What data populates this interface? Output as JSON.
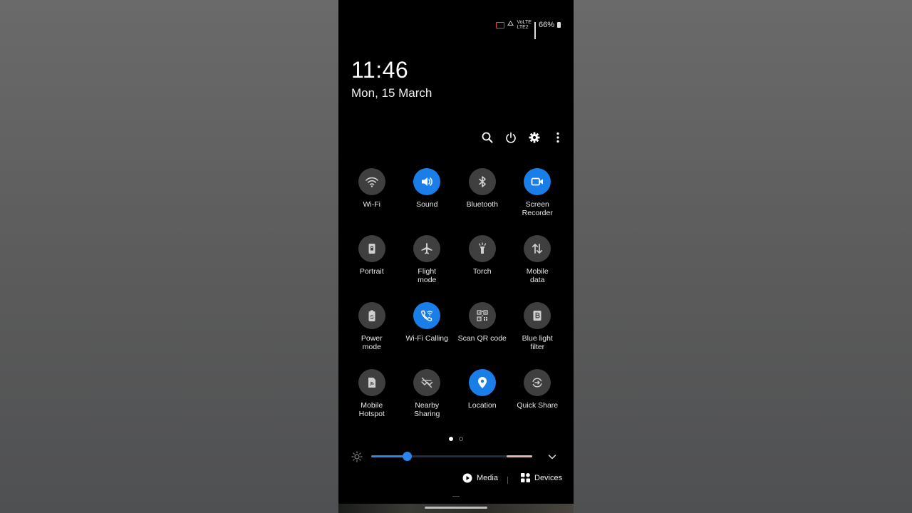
{
  "status_bar": {
    "battery_percent": "66%",
    "volte_label": "VoLTE",
    "lte_label": "LTE2"
  },
  "clock": {
    "time": "11:46",
    "date": "Mon, 15 March"
  },
  "top_actions": [
    "search-icon",
    "power-icon",
    "gear-icon",
    "more-vertical-icon"
  ],
  "tiles": [
    {
      "label": "Wi-Fi",
      "icon": "wifi-icon",
      "on": false
    },
    {
      "label": "Sound",
      "icon": "speaker-icon",
      "on": true
    },
    {
      "label": "Bluetooth",
      "icon": "bluetooth-icon",
      "on": false
    },
    {
      "label": "Screen\nRecorder",
      "icon": "video-camera-icon",
      "on": true
    },
    {
      "label": "Portrait",
      "icon": "rotation-lock-icon",
      "on": false
    },
    {
      "label": "Flight\nmode",
      "icon": "airplane-icon",
      "on": false
    },
    {
      "label": "Torch",
      "icon": "flashlight-icon",
      "on": false
    },
    {
      "label": "Mobile\ndata",
      "icon": "data-arrows-icon",
      "on": false
    },
    {
      "label": "Power\nmode",
      "icon": "battery-recycle-icon",
      "on": false
    },
    {
      "label": "Wi-Fi Calling",
      "icon": "wifi-call-icon",
      "on": true
    },
    {
      "label": "Scan QR code",
      "icon": "qr-code-icon",
      "on": false
    },
    {
      "label": "Blue light\nfilter",
      "icon": "blue-light-icon",
      "on": false
    },
    {
      "label": "Mobile\nHotspot",
      "icon": "hotspot-icon",
      "on": false
    },
    {
      "label": "Nearby\nSharing",
      "icon": "nearby-share-icon",
      "on": false
    },
    {
      "label": "Location",
      "icon": "location-pin-icon",
      "on": true
    },
    {
      "label": "Quick Share",
      "icon": "quick-share-icon",
      "on": false
    }
  ],
  "pager": {
    "current_page": 1,
    "total_pages": 2
  },
  "brightness": {
    "level": 0.22
  },
  "bottom": {
    "media_label": "Media",
    "devices_label": "Devices"
  },
  "colors": {
    "accent": "#1a7ee8",
    "tile_off": "#3f3f3f",
    "background": "#000000"
  }
}
